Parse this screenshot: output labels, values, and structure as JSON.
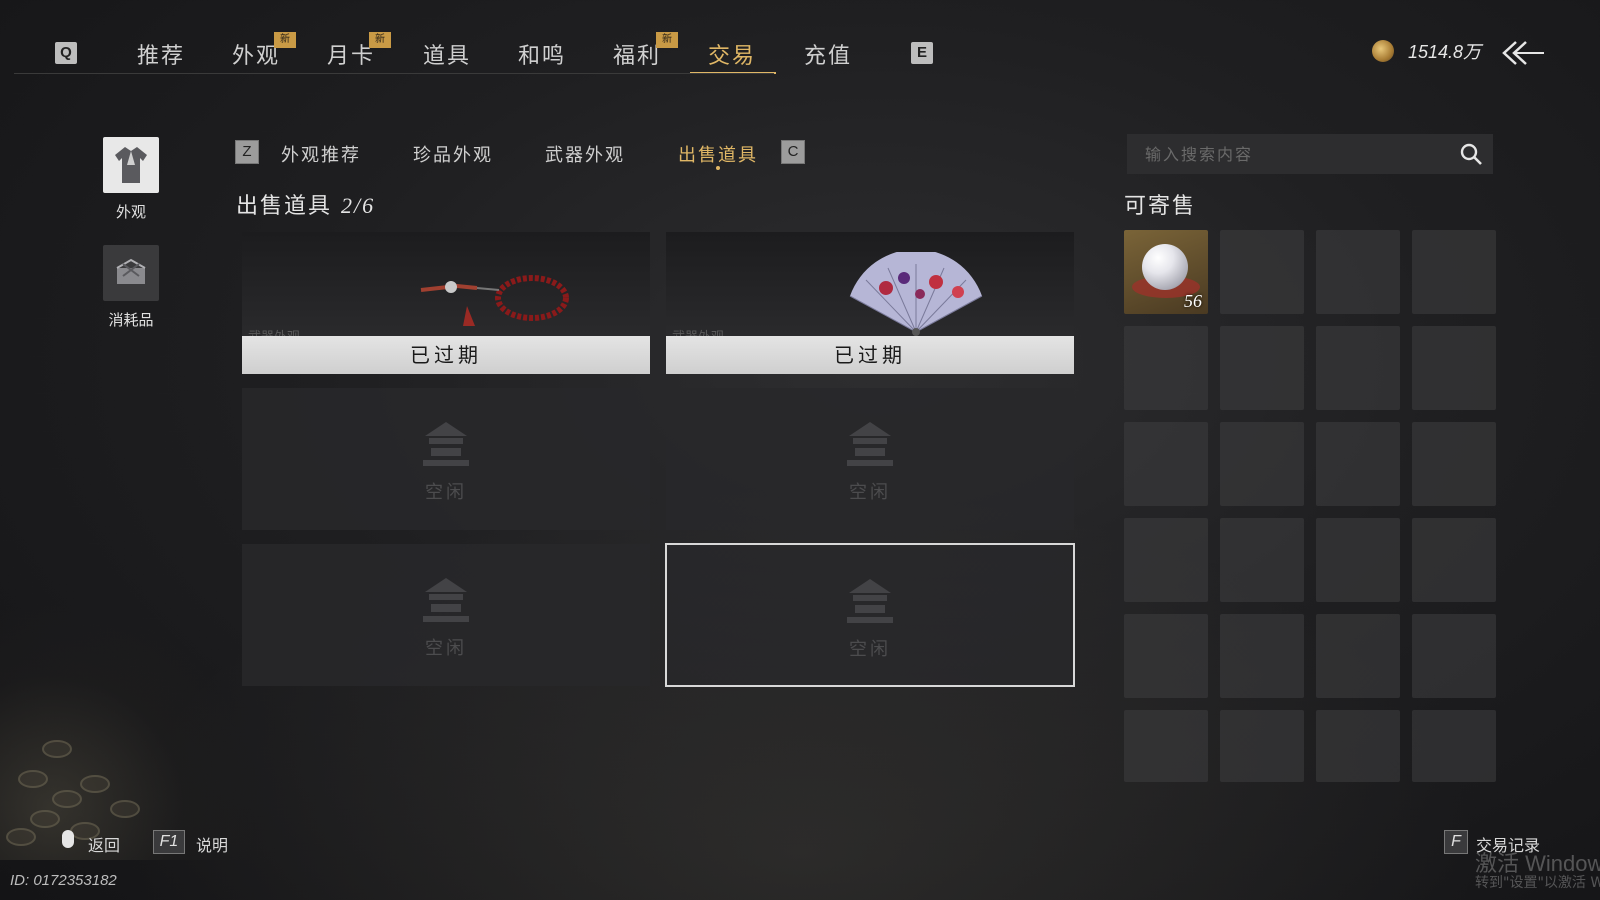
{
  "top_nav": {
    "left_key": "Q",
    "right_key": "E",
    "tabs": [
      {
        "label": "推荐",
        "badge": ""
      },
      {
        "label": "外观",
        "badge": "新"
      },
      {
        "label": "月卡",
        "badge": "新"
      },
      {
        "label": "道具",
        "badge": ""
      },
      {
        "label": "和鸣",
        "badge": ""
      },
      {
        "label": "福利",
        "badge": "新"
      },
      {
        "label": "交易",
        "badge": "",
        "active": true
      },
      {
        "label": "充值",
        "badge": ""
      }
    ],
    "currency": {
      "value": "1514.8万",
      "icon": "coin-icon"
    },
    "back_icon": "back-arrow-icon"
  },
  "sidebar": {
    "items": [
      {
        "label": "外观",
        "icon": "robe-icon",
        "active": true
      },
      {
        "label": "消耗品",
        "icon": "package-icon",
        "active": false
      }
    ]
  },
  "sub_nav": {
    "left_key": "Z",
    "right_key": "C",
    "tabs": [
      {
        "label": "外观推荐"
      },
      {
        "label": "珍品外观"
      },
      {
        "label": "武器外观"
      },
      {
        "label": "出售道具",
        "active": true
      }
    ]
  },
  "sale_section": {
    "title": "出售道具",
    "count": "2/6",
    "slots": [
      {
        "state": "expired",
        "status": "已过期",
        "category": "武器外观",
        "item": "prayer-beads-image"
      },
      {
        "state": "expired",
        "status": "已过期",
        "category": "武器外观",
        "item": "maple-fan-image"
      },
      {
        "state": "empty",
        "status": "空闲"
      },
      {
        "state": "empty",
        "status": "空闲"
      },
      {
        "state": "empty",
        "status": "空闲"
      },
      {
        "state": "empty",
        "status": "空闲",
        "selected": true
      }
    ]
  },
  "search": {
    "placeholder": "输入搜索内容",
    "icon": "search-icon"
  },
  "sellable": {
    "title": "可寄售",
    "items": [
      {
        "icon": "pearl-icon",
        "qty": "56"
      }
    ],
    "total_cells": 24
  },
  "footer": {
    "back_label": "返回",
    "help_key": "F1",
    "help_label": "说明",
    "record_key": "F",
    "record_label": "交易记录",
    "player_id": "ID: 0172353182",
    "watermark_line1": "激活 Windows",
    "watermark_line2": "转到\"设置\"以激活 W"
  },
  "colors": {
    "accent": "#e0b766",
    "badge": "#c99a45"
  }
}
